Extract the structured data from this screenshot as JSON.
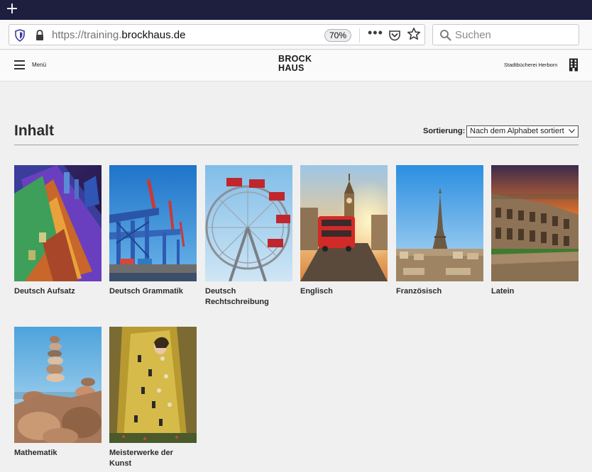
{
  "browser": {
    "url_prefix": "https://training.",
    "url_domain": "brockhaus.de",
    "zoom": "70%",
    "search_placeholder": "Suchen"
  },
  "header": {
    "menu_label": "Menü",
    "logo_line1": "BROCK",
    "logo_line2": "HAUS",
    "library_name": "Stadtbücherei Herborn"
  },
  "content": {
    "title": "Inhalt",
    "sort_label": "Sortierung:",
    "sort_value": "Nach dem Alphabet sortiert"
  },
  "courses": [
    {
      "label": "Deutsch Aufsatz",
      "image": "brandenburg-gate"
    },
    {
      "label": "Deutsch Grammatik",
      "image": "harbor-cranes"
    },
    {
      "label": "Deutsch Rechtschreibung",
      "image": "ferris-wheel"
    },
    {
      "label": "Englisch",
      "image": "big-ben-bus"
    },
    {
      "label": "Französisch",
      "image": "eiffel-tower"
    },
    {
      "label": "Latein",
      "image": "colosseum"
    },
    {
      "label": "Mathematik",
      "image": "stacked-stones"
    },
    {
      "label": "Meisterwerke der Kunst",
      "image": "the-kiss-painting"
    }
  ],
  "colors": {
    "tabbar": "#1e1f3f",
    "page_background": "#f0f0f0"
  }
}
